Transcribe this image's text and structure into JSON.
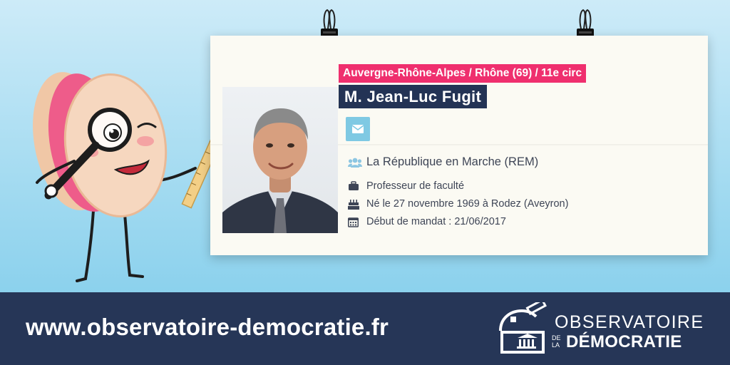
{
  "card": {
    "region": "Auvergne-Rhône-Alpes / Rhône (69) / 11e circ",
    "name": "M. Jean-Luc Fugit",
    "party": "La République en Marche (REM)",
    "job": "Professeur de faculté",
    "born": "Né le 27 novembre 1969 à Rodez (Aveyron)",
    "mandate": "Début de mandat : 21/06/2017"
  },
  "footer": {
    "website": "www.observatoire-democratie.fr",
    "brand_line1": "OBSERVATOIRE",
    "brand_de": "DE",
    "brand_la": "LA",
    "brand_line2": "DÉMOCRATIE"
  },
  "colors": {
    "region_bg": "#ef2f6e",
    "name_bg": "#233355",
    "mail_bg": "#7fc9e3",
    "footer_bg": "#263657",
    "sky": "#9fd9f0"
  },
  "icons": [
    "binder-clip-icon",
    "envelope-icon",
    "group-icon",
    "briefcase-icon",
    "birthday-cake-icon",
    "calendar-icon",
    "observatory-logo-icon"
  ]
}
